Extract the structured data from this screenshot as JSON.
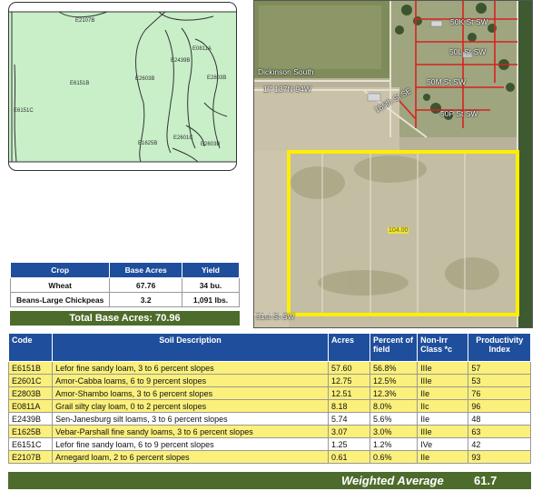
{
  "soil_map": {
    "labels": [
      "E2107B",
      "E6151B",
      "E2603B",
      "E0811A",
      "E2439B",
      "E2803B",
      "E1625B",
      "E2601C",
      "E2603B",
      "E6151C"
    ]
  },
  "aerial": {
    "labels": [
      "Dickinson South",
      "17-137N-94W",
      "50K St SW",
      "50L St SW",
      "50M St SW",
      "50P St SW",
      "185th St SE",
      "51st St SW"
    ],
    "field_acres": "104.00"
  },
  "crop_table": {
    "headers": [
      "Crop",
      "Base Acres",
      "Yield"
    ],
    "rows": [
      [
        "Wheat",
        "67.76",
        "34 bu."
      ],
      [
        "Beans-Large Chickpeas",
        "3.2",
        "1,091 lbs."
      ]
    ],
    "total": "Total Base Acres:  70.96"
  },
  "soil_table": {
    "headers": {
      "code": "Code",
      "description": "Soil Description",
      "acres": "Acres",
      "percent": "Percent of field",
      "class": "Non-Irr Class *c",
      "index": "Productivity Index"
    },
    "rows": [
      {
        "code": "E6151B",
        "description": "Lefor fine sandy loam, 3 to 6 percent slopes",
        "acres": "57.60",
        "percent": "56.8%",
        "class": "IIIe",
        "index": "57"
      },
      {
        "code": "E2601C",
        "description": "Amor-Cabba loams, 6 to 9 percent slopes",
        "acres": "12.75",
        "percent": "12.5%",
        "class": "IIIe",
        "index": "53"
      },
      {
        "code": "E2803B",
        "description": "Amor-Shambo loams, 3 to 6 percent slopes",
        "acres": "12.51",
        "percent": "12.3%",
        "class": "IIe",
        "index": "76"
      },
      {
        "code": "E0811A",
        "description": "Grail silty clay loam, 0 to 2 percent slopes",
        "acres": "8.18",
        "percent": "8.0%",
        "class": "IIc",
        "index": "96"
      },
      {
        "code": "E2439B",
        "description": "Sen-Janesburg silt loams, 3 to 6 percent slopes",
        "acres": "5.74",
        "percent": "5.6%",
        "class": "IIe",
        "index": "48"
      },
      {
        "code": "E1625B",
        "description": "Vebar-Parshall fine sandy loams, 3 to 6 percent slopes",
        "acres": "3.07",
        "percent": "3.0%",
        "class": "IIIe",
        "index": "63"
      },
      {
        "code": "E6151C",
        "description": "Lefor fine sandy loam, 6 to 9 percent slopes",
        "acres": "1.25",
        "percent": "1.2%",
        "class": "IVe",
        "index": "42"
      },
      {
        "code": "E2107B",
        "description": "Arnegard loam, 2 to 6 percent slopes",
        "acres": "0.61",
        "percent": "0.6%",
        "class": "IIe",
        "index": "93"
      }
    ],
    "row_highlight": [
      true,
      true,
      true,
      true,
      false,
      true,
      false,
      true
    ],
    "weighted_label": "Weighted Average",
    "weighted_value": "61.7"
  },
  "colors": {
    "header_blue": "#1f4e9c",
    "total_green": "#4d6b2b",
    "row_yellow": "#fbf07b",
    "map_green": "#c6efc6",
    "field_outline": "#ffee00"
  }
}
